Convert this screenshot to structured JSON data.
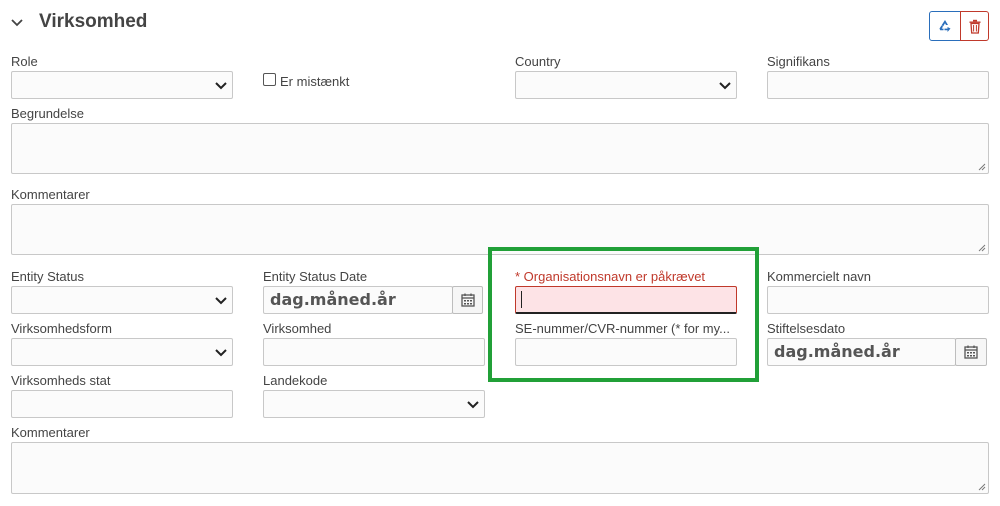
{
  "section": {
    "title": "Virksomhed"
  },
  "actions": {
    "recycle_icon": "recycle-icon",
    "delete_icon": "trash-icon",
    "recycle_color": "#2a6ebb",
    "delete_color": "#c0392b"
  },
  "fields": {
    "role": {
      "label": "Role",
      "value": ""
    },
    "suspect": {
      "label": "Er mistænkt",
      "checked": false
    },
    "country": {
      "label": "Country",
      "value": ""
    },
    "significance": {
      "label": "Signifikans",
      "value": ""
    },
    "reasoning": {
      "label": "Begrundelse",
      "value": ""
    },
    "comments1": {
      "label": "Kommentarer",
      "value": ""
    },
    "entity_status": {
      "label": "Entity Status",
      "value": ""
    },
    "entity_status_date": {
      "label": "Entity Status Date",
      "placeholder": "dag.måned.år"
    },
    "org_name": {
      "label": "* Organisationsnavn er påkrævet",
      "value": "",
      "error_color": "#c0392b"
    },
    "commercial_name": {
      "label": "Kommercielt navn",
      "value": ""
    },
    "company_form": {
      "label": "Virksomhedsform",
      "value": ""
    },
    "company": {
      "label": "Virksomhed",
      "value": ""
    },
    "se_cvr": {
      "label": "SE-nummer/CVR-nummer (* for my...",
      "value": ""
    },
    "founding_date": {
      "label": "Stiftelsesdato",
      "placeholder": "dag.måned.år"
    },
    "company_state": {
      "label": "Virksomheds stat",
      "value": ""
    },
    "country_code": {
      "label": "Landekode",
      "value": ""
    },
    "comments2": {
      "label": "Kommentarer",
      "value": ""
    }
  },
  "highlight": {
    "color": "#21a038"
  }
}
